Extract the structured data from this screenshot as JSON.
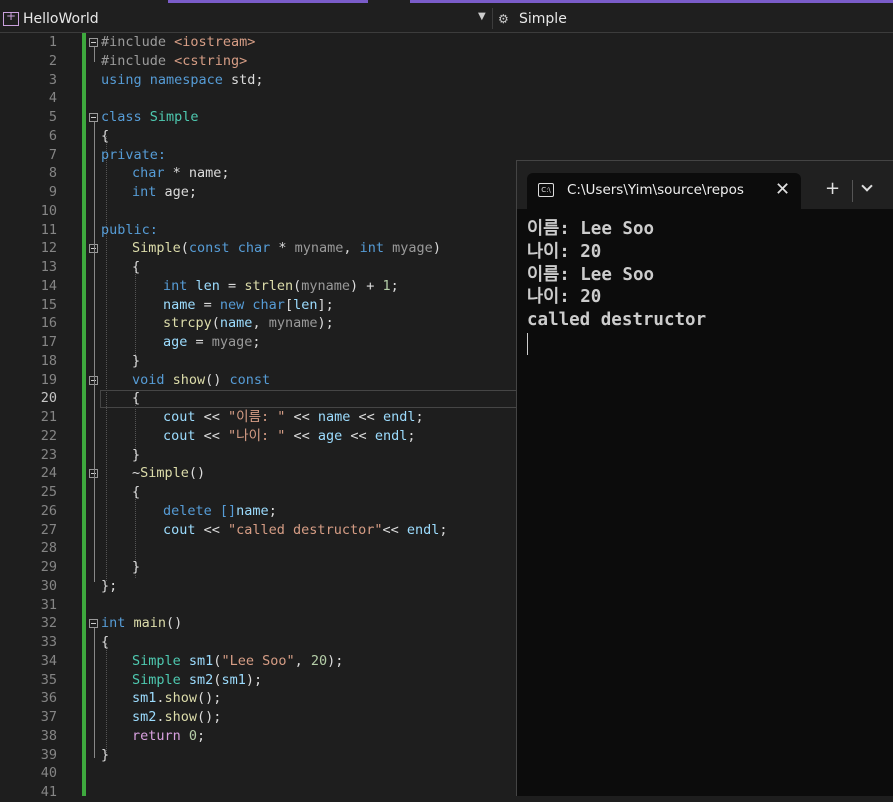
{
  "navbar": {
    "project": "HelloWorld",
    "member": "Simple"
  },
  "line_numbers": [
    "1",
    "2",
    "3",
    "4",
    "5",
    "6",
    "7",
    "8",
    "9",
    "10",
    "11",
    "12",
    "13",
    "14",
    "15",
    "16",
    "17",
    "18",
    "19",
    "20",
    "21",
    "22",
    "23",
    "24",
    "25",
    "26",
    "27",
    "28",
    "29",
    "30",
    "31",
    "32",
    "33",
    "34",
    "35",
    "36",
    "37",
    "38",
    "39",
    "40",
    "41"
  ],
  "code": {
    "l1": {
      "a": "#include ",
      "b": "<iostream>"
    },
    "l2": {
      "a": "#include ",
      "b": "<cstring>"
    },
    "l3": {
      "a": "using namespace ",
      "b": "std;"
    },
    "l5": {
      "a": "class ",
      "b": "Simple"
    },
    "l6": {
      "a": "{"
    },
    "l7": {
      "a": "private:"
    },
    "l8": {
      "a": "char",
      "b": " * ",
      "c": "name;"
    },
    "l9": {
      "a": "int",
      "b": " ",
      "c": "age;"
    },
    "l11": {
      "a": "public:"
    },
    "l12": {
      "a": "Simple",
      "b": "(",
      "c": "const char",
      "d": " * ",
      "e": "myname",
      "f": ", ",
      "g": "int",
      "h": " ",
      "i": "myage",
      ")": ")"
    },
    "l13": {
      "a": "{"
    },
    "l14": {
      "a": "int",
      "b": " ",
      "c": "len",
      "d": " = ",
      "e": "strlen",
      "f": "(",
      "g": "myname",
      "h": ") + ",
      "i": "1",
      "j": ";"
    },
    "l15": {
      "a": "name",
      "b": " = ",
      "c": "new char",
      "d": "[",
      "e": "len",
      "f": "];"
    },
    "l16": {
      "a": "strcpy",
      "b": "(",
      "c": "name",
      "d": ", ",
      "e": "myname",
      "f": ");"
    },
    "l17": {
      "a": "age",
      "b": " = ",
      "c": "myage",
      "d": ";"
    },
    "l18": {
      "a": "}"
    },
    "l19": {
      "a": "void ",
      "b": "show",
      "c": "() ",
      "d": "const"
    },
    "l20": {
      "a": "{"
    },
    "l21": {
      "a": "cout",
      "b": " << ",
      "c": "\"이름: \"",
      "d": " << ",
      "e": "name",
      "f": " << ",
      "g": "endl",
      "h": ";"
    },
    "l22": {
      "a": "cout",
      "b": " << ",
      "c": "\"나이: \"",
      "d": " << ",
      "e": "age",
      "f": " << ",
      "g": "endl",
      "h": ";"
    },
    "l23": {
      "a": "}"
    },
    "l24": {
      "a": "~",
      "b": "Simple",
      "c": "()"
    },
    "l25": {
      "a": "{"
    },
    "l26": {
      "a": "delete ",
      "b": "[]",
      "c": "name",
      "d": ";"
    },
    "l27": {
      "a": "cout",
      "b": " << ",
      "c": "\"called destructor\"",
      "d": "<< ",
      "e": "endl",
      "f": ";"
    },
    "l29": {
      "a": "}"
    },
    "l30": {
      "a": "};"
    },
    "l32": {
      "a": "int ",
      "b": "main",
      "c": "()"
    },
    "l33": {
      "a": "{"
    },
    "l34": {
      "a": "Simple ",
      "b": "sm1",
      "c": "(",
      "d": "\"Lee Soo\"",
      "e": ", ",
      "f": "20",
      "g": ");"
    },
    "l35": {
      "a": "Simple ",
      "b": "sm2",
      "c": "(",
      "d": "sm1",
      "e": ");"
    },
    "l36": {
      "a": "sm1",
      "b": ".",
      "c": "show",
      "d": "();"
    },
    "l37": {
      "a": "sm2",
      "b": ".",
      "c": "show",
      "d": "();"
    },
    "l38": {
      "a": "return ",
      "b": "0",
      "c": ";"
    },
    "l39": {
      "a": "}"
    }
  },
  "terminal": {
    "tab_title": "C:\\Users\\Yim\\source\\repos",
    "close": "✕",
    "new_tab": "+",
    "output": [
      "이름: Lee Soo",
      "나이: 20",
      "이름: Lee Soo",
      "나이: 20",
      "called destructor"
    ]
  },
  "colors": {
    "accent": "#7a5cc9",
    "change_bar": "#3ea93e",
    "keyword": "#569cd6",
    "type": "#4ec9b0",
    "string": "#d69d85"
  }
}
